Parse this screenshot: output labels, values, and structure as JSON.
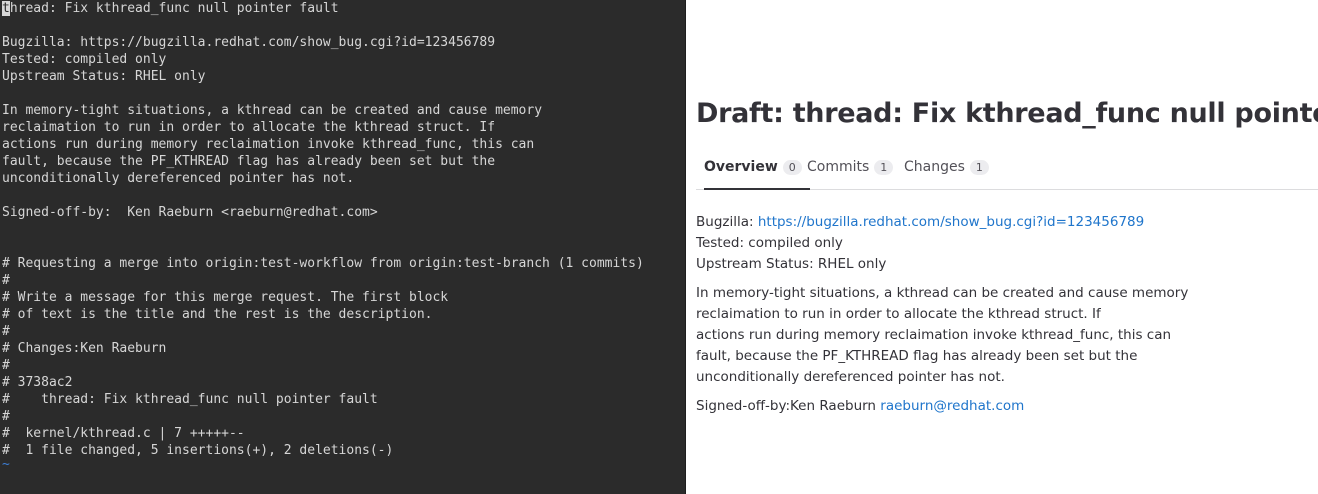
{
  "terminal": {
    "lines": [
      "thread: Fix kthread_func null pointer fault",
      "",
      "Bugzilla: https://bugzilla.redhat.com/show_bug.cgi?id=123456789",
      "Tested: compiled only",
      "Upstream Status: RHEL only",
      "",
      "In memory-tight situations, a kthread can be created and cause memory",
      "reclaimation to run in order to allocate the kthread struct. If",
      "actions run during memory reclaimation invoke kthread_func, this can",
      "fault, because the PF_KTHREAD flag has already been set but the",
      "unconditionally dereferenced pointer has not.",
      "",
      "Signed-off-by:  Ken Raeburn <raeburn@redhat.com>",
      "",
      "",
      "# Requesting a merge into origin:test-workflow from origin:test-branch (1 commits)",
      "#",
      "# Write a message for this merge request. The first block",
      "# of text is the title and the rest is the description.",
      "#",
      "# Changes:Ken Raeburn",
      "#",
      "# 3738ac2",
      "#    thread: Fix kthread_func null pointer fault",
      "#",
      "#  kernel/kthread.c | 7 +++++--",
      "#  1 file changed, 5 insertions(+), 2 deletions(-)",
      "~"
    ]
  },
  "mr": {
    "title": "Draft: thread: Fix kthread_func null pointer fault",
    "tabs": [
      {
        "label": "Overview",
        "count": "0"
      },
      {
        "label": "Commits",
        "count": "1"
      },
      {
        "label": "Changes",
        "count": "1"
      }
    ],
    "description": {
      "bugzilla_label": "Bugzilla: ",
      "bugzilla_link": "https://bugzilla.redhat.com/show_bug.cgi?id=123456789",
      "tested": "Tested: compiled only",
      "upstream": "Upstream Status: RHEL only",
      "para": [
        "In memory-tight situations, a kthread can be created and cause memory",
        "reclaimation to run in order to allocate the kthread struct. If",
        "actions run during memory reclaimation invoke kthread_func, this can",
        "fault, because the PF_KTHREAD flag has already been set but the",
        "unconditionally dereferenced pointer has not."
      ],
      "signoff_label": "Signed-off-by:Ken Raeburn ",
      "signoff_email": "raeburn@redhat.com"
    }
  }
}
